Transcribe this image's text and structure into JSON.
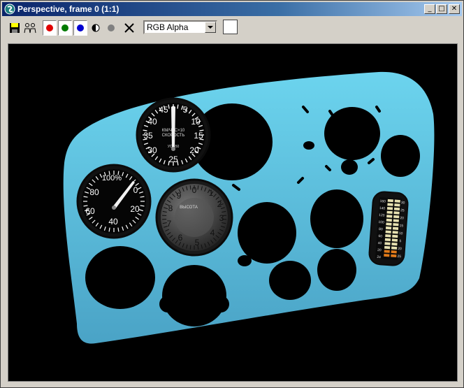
{
  "window": {
    "title": "Perspective, frame 0 (1:1)",
    "controls": {
      "minimize": "_",
      "maximize": "□",
      "close": "✕"
    }
  },
  "toolbar": {
    "channel_select": {
      "value": "RGB Alpha"
    },
    "colors": {
      "red": "#e00000",
      "green": "#007a00",
      "blue": "#0000d0",
      "mono": "#808080"
    },
    "icons": [
      "save-icon",
      "clone-icon",
      "red-channel-icon",
      "green-channel-icon",
      "blue-channel-icon",
      "monochrome-icon",
      "alpha-icon",
      "clear-icon",
      "dropdown-arrow-icon"
    ]
  },
  "render": {
    "background": "#000000",
    "panel_color": "#5bbad8",
    "airspeed": {
      "labels": [
        "45",
        "5",
        "40",
        "10",
        "35",
        "15",
        "30",
        "20",
        "25"
      ],
      "center_text": [
        "КМ/ЧАС×10",
        "СКОРОСТЬ",
        "УС 450"
      ]
    },
    "percent": {
      "labels": [
        "100%",
        "80",
        "0",
        "60",
        "20",
        "40"
      ]
    },
    "altimeter": {
      "labels": [
        "0",
        "1",
        "2",
        "3",
        "4",
        "5",
        "6",
        "7",
        "8",
        "9"
      ],
      "center_text": "ВЫСОТА"
    },
    "bar_gauge": {
      "left_labels": [
        "160",
        "140",
        "120",
        "100",
        "80",
        "60",
        "40",
        "20",
        "24"
      ],
      "right_labels": [
        "30",
        "25",
        "20",
        "15",
        "10",
        "5",
        "20",
        "25"
      ]
    }
  }
}
